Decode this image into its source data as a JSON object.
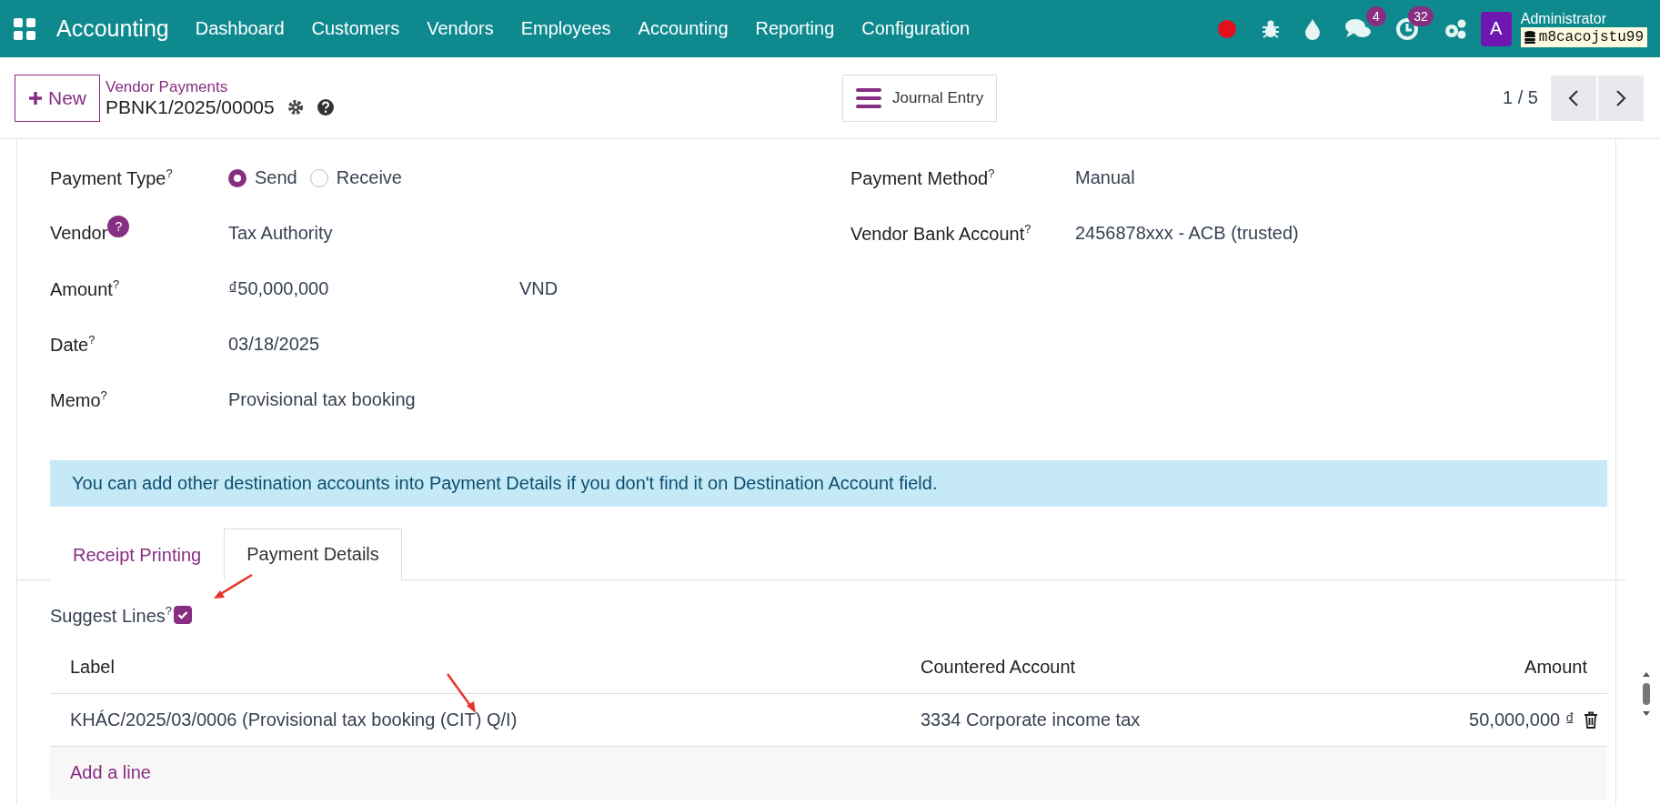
{
  "navbar": {
    "app_name": "Accounting",
    "menu": [
      "Dashboard",
      "Customers",
      "Vendors",
      "Employees",
      "Accounting",
      "Reporting",
      "Configuration"
    ],
    "chat_count": "4",
    "activity_count": "32",
    "avatar_letter": "A",
    "user_name": "Administrator",
    "database": "m8cacojstu99"
  },
  "control_panel": {
    "new_button": "New",
    "breadcrumb": "Vendor Payments",
    "record_name": "PBNK1/2025/00005",
    "smart_button": "Journal Entry",
    "pager": "1 / 5"
  },
  "form": {
    "payment_type": {
      "label": "Payment Type",
      "help": "?",
      "options": [
        {
          "label": "Send",
          "selected": true
        },
        {
          "label": "Receive",
          "selected": false
        }
      ]
    },
    "left_fields": [
      {
        "label": "Vendor",
        "help_badge": "?",
        "value": "Tax Authority"
      },
      {
        "label": "Amount",
        "help": "?",
        "value": "₫50,000,000",
        "currency": "VND"
      },
      {
        "label": "Date",
        "help": "?",
        "value": "03/18/2025"
      },
      {
        "label": "Memo",
        "help": "?",
        "value": "Provisional tax booking"
      }
    ],
    "right_fields": [
      {
        "label": "Payment Method",
        "help": "?",
        "value": "Manual"
      },
      {
        "label": "Vendor Bank Account",
        "help": "?",
        "value": "2456878xxx - ACB (trusted)"
      }
    ],
    "alert": "You can add other destination accounts into Payment Details if you don't find it on Destination Account field.",
    "tabs": [
      {
        "label": "Receipt Printing",
        "selected": false
      },
      {
        "label": "Payment Details",
        "selected": true
      }
    ],
    "suggest_lines": {
      "label": "Suggest Lines",
      "help": "?",
      "checked": true
    },
    "table": {
      "columns": [
        "Label",
        "Countered Account",
        "Amount"
      ],
      "rows": [
        {
          "label": "KHÁC/2025/03/0006 (Provisional tax booking (CIT) Q/I)",
          "account": "3334 Corporate income tax",
          "amount": "50,000,000 ₫"
        }
      ],
      "add_line": "Add a line"
    }
  }
}
